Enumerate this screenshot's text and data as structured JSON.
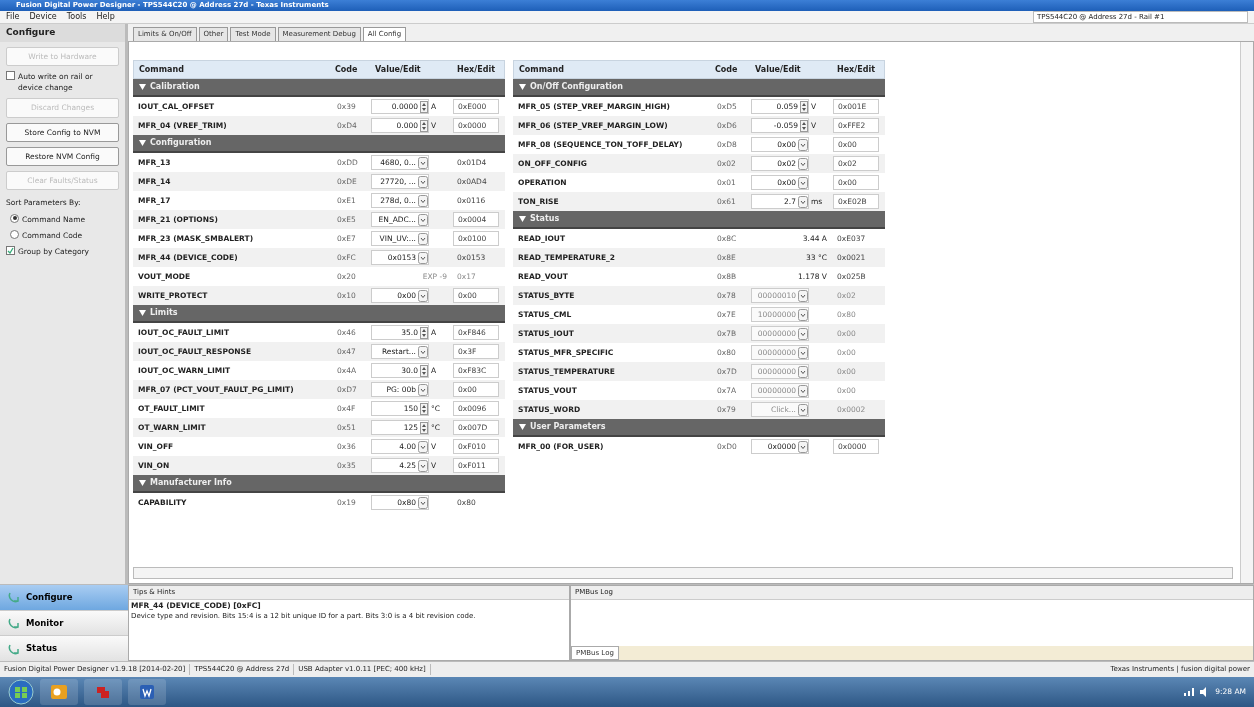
{
  "window": {
    "title": "Fusion Digital Power Designer - TPS544C20 @ Address 27d - Texas Instruments"
  },
  "menu": [
    "File",
    "Device",
    "Tools",
    "Help"
  ],
  "device_selector": {
    "value": "TPS544C20 @ Address 27d - Rail #1"
  },
  "sidebar": {
    "title": "Configure",
    "controls": [
      {
        "kind": "button",
        "label": "Write to Hardware",
        "disabled": true
      },
      {
        "kind": "checkbox",
        "label": "Auto write on rail or device change",
        "checked": false
      },
      {
        "kind": "button",
        "label": "Discard Changes",
        "disabled": true
      },
      {
        "kind": "button",
        "label": "Store Config to NVM",
        "disabled": false
      },
      {
        "kind": "button",
        "label": "Restore NVM Config",
        "disabled": false
      },
      {
        "kind": "button",
        "label": "Clear Faults/Status",
        "disabled": true
      },
      {
        "kind": "label",
        "label": "Sort Parameters By:"
      },
      {
        "kind": "radio",
        "label": "Command Name",
        "selected": true
      },
      {
        "kind": "radio",
        "label": "Command Code",
        "selected": false
      },
      {
        "kind": "checkbox",
        "label": "Group by Category",
        "checked": true
      }
    ]
  },
  "tabs": [
    {
      "label": "Limits & On/Off",
      "selected": false
    },
    {
      "label": "Other",
      "selected": false
    },
    {
      "label": "Test Mode",
      "selected": false
    },
    {
      "label": "Measurement Debug",
      "selected": false
    },
    {
      "label": "All Config",
      "selected": true
    }
  ],
  "tables": [
    {
      "columns": [
        "Command",
        "Code",
        "Value/Edit",
        "Hex/Edit"
      ],
      "groups": [
        {
          "title": "Calibration",
          "expanded": true,
          "rows": [
            {
              "command": "IOUT_CAL_OFFSET",
              "code": "0x39",
              "kind": "spin",
              "value": "0.0000",
              "unit": "A",
              "hex": "0xE000",
              "hex_editable": true,
              "disabled": false
            },
            {
              "command": "MFR_04 (VREF_TRIM)",
              "code": "0xD4",
              "kind": "spin",
              "value": "0.000",
              "unit": "V",
              "hex": "0x0000",
              "hex_editable": true,
              "disabled": false
            }
          ]
        },
        {
          "title": "Configuration",
          "expanded": true,
          "rows": [
            {
              "command": "MFR_13",
              "code": "0xDD",
              "kind": "combo",
              "value": "4680, 0...",
              "hex": "0x01D4",
              "hex_editable": false,
              "disabled": false
            },
            {
              "command": "MFR_14",
              "code": "0xDE",
              "kind": "combo",
              "value": "27720, ...",
              "hex": "0x0AD4",
              "hex_editable": false,
              "disabled": false
            },
            {
              "command": "MFR_17",
              "code": "0xE1",
              "kind": "combo",
              "value": "278d, 0...",
              "hex": "0x0116",
              "hex_editable": false,
              "disabled": false
            },
            {
              "command": "MFR_21 (OPTIONS)",
              "code": "0xE5",
              "kind": "combo",
              "value": "EN_ADC...",
              "hex": "0x0004",
              "hex_editable": true,
              "disabled": false
            },
            {
              "command": "MFR_23 (MASK_SMBALERT)",
              "code": "0xE7",
              "kind": "combo",
              "value": "VIN_UV:...",
              "hex": "0x0100",
              "hex_editable": true,
              "disabled": false
            },
            {
              "command": "MFR_44 (DEVICE_CODE)",
              "code": "0xFC",
              "kind": "combo",
              "value": "0x0153",
              "hex": "0x0153",
              "hex_editable": false,
              "disabled": false
            },
            {
              "command": "VOUT_MODE",
              "code": "0x20",
              "kind": "text",
              "value": "EXP -9",
              "hex": "0x17",
              "hex_editable": false,
              "disabled": true
            },
            {
              "command": "WRITE_PROTECT",
              "code": "0x10",
              "kind": "combo",
              "value": "0x00",
              "hex": "0x00",
              "hex_editable": true,
              "disabled": false
            }
          ]
        },
        {
          "title": "Limits",
          "expanded": true,
          "rows": [
            {
              "command": "IOUT_OC_FAULT_LIMIT",
              "code": "0x46",
              "kind": "spin",
              "value": "35.0",
              "unit": "A",
              "hex": "0xF846",
              "hex_editable": true,
              "disabled": false
            },
            {
              "command": "IOUT_OC_FAULT_RESPONSE",
              "code": "0x47",
              "kind": "combo",
              "value": "Restart...",
              "hex": "0x3F",
              "hex_editable": true,
              "disabled": false
            },
            {
              "command": "IOUT_OC_WARN_LIMIT",
              "code": "0x4A",
              "kind": "spin",
              "value": "30.0",
              "unit": "A",
              "hex": "0xF83C",
              "hex_editable": true,
              "disabled": false
            },
            {
              "command": "MFR_07 (PCT_VOUT_FAULT_PG_LIMIT)",
              "code": "0xD7",
              "kind": "combo",
              "value": "PG: 00b",
              "hex": "0x00",
              "hex_editable": true,
              "disabled": false
            },
            {
              "command": "OT_FAULT_LIMIT",
              "code": "0x4F",
              "kind": "spin",
              "value": "150",
              "unit": "°C",
              "hex": "0x0096",
              "hex_editable": true,
              "disabled": false
            },
            {
              "command": "OT_WARN_LIMIT",
              "code": "0x51",
              "kind": "spin",
              "value": "125",
              "unit": "°C",
              "hex": "0x007D",
              "hex_editable": true,
              "disabled": false
            },
            {
              "command": "VIN_OFF",
              "code": "0x36",
              "kind": "combo",
              "value": "4.00",
              "unit": "V",
              "hex": "0xF010",
              "hex_editable": true,
              "disabled": false
            },
            {
              "command": "VIN_ON",
              "code": "0x35",
              "kind": "combo",
              "value": "4.25",
              "unit": "V",
              "hex": "0xF011",
              "hex_editable": true,
              "disabled": false
            }
          ]
        },
        {
          "title": "Manufacturer Info",
          "expanded": true,
          "rows": [
            {
              "command": "CAPABILITY",
              "code": "0x19",
              "kind": "combo",
              "value": "0x80",
              "hex": "0x80",
              "hex_editable": false,
              "disabled": false
            }
          ]
        }
      ]
    },
    {
      "columns": [
        "Command",
        "Code",
        "Value/Edit",
        "Hex/Edit"
      ],
      "groups": [
        {
          "title": "On/Off Configuration",
          "expanded": true,
          "rows": [
            {
              "command": "MFR_05 (STEP_VREF_MARGIN_HIGH)",
              "code": "0xD5",
              "kind": "spin",
              "value": "0.059",
              "unit": "V",
              "hex": "0x001E",
              "hex_editable": true,
              "disabled": false
            },
            {
              "command": "MFR_06 (STEP_VREF_MARGIN_LOW)",
              "code": "0xD6",
              "kind": "spin",
              "value": "-0.059",
              "unit": "V",
              "hex": "0xFFE2",
              "hex_editable": true,
              "disabled": false
            },
            {
              "command": "MFR_08 (SEQUENCE_TON_TOFF_DELAY)",
              "code": "0xD8",
              "kind": "combo",
              "value": "0x00",
              "hex": "0x00",
              "hex_editable": true,
              "disabled": false
            },
            {
              "command": "ON_OFF_CONFIG",
              "code": "0x02",
              "kind": "combo",
              "value": "0x02",
              "hex": "0x02",
              "hex_editable": true,
              "disabled": false
            },
            {
              "command": "OPERATION",
              "code": "0x01",
              "kind": "combo",
              "value": "0x00",
              "hex": "0x00",
              "hex_editable": true,
              "disabled": false
            },
            {
              "command": "TON_RISE",
              "code": "0x61",
              "kind": "combo",
              "value": "2.7",
              "unit": "ms",
              "hex": "0xE02B",
              "hex_editable": true,
              "disabled": false
            }
          ]
        },
        {
          "title": "Status",
          "expanded": true,
          "rows": [
            {
              "command": "READ_IOUT",
              "code": "0x8C",
              "kind": "text",
              "value": "3.44 A",
              "hex": "0xE037",
              "hex_editable": false,
              "disabled": false
            },
            {
              "command": "READ_TEMPERATURE_2",
              "code": "0x8E",
              "kind": "text",
              "value": "33 °C",
              "hex": "0x0021",
              "hex_editable": false,
              "disabled": false
            },
            {
              "command": "READ_VOUT",
              "code": "0x8B",
              "kind": "text",
              "value": "1.178 V",
              "hex": "0x025B",
              "hex_editable": false,
              "disabled": false
            },
            {
              "command": "STATUS_BYTE",
              "code": "0x78",
              "kind": "combo",
              "value": "00000010",
              "hex": "0x02",
              "hex_editable": false,
              "disabled": true
            },
            {
              "command": "STATUS_CML",
              "code": "0x7E",
              "kind": "combo",
              "value": "10000000",
              "hex": "0x80",
              "hex_editable": false,
              "disabled": true
            },
            {
              "command": "STATUS_IOUT",
              "code": "0x7B",
              "kind": "combo",
              "value": "00000000",
              "hex": "0x00",
              "hex_editable": false,
              "disabled": true
            },
            {
              "command": "STATUS_MFR_SPECIFIC",
              "code": "0x80",
              "kind": "combo",
              "value": "00000000",
              "hex": "0x00",
              "hex_editable": false,
              "disabled": true
            },
            {
              "command": "STATUS_TEMPERATURE",
              "code": "0x7D",
              "kind": "combo",
              "value": "00000000",
              "hex": "0x00",
              "hex_editable": false,
              "disabled": true
            },
            {
              "command": "STATUS_VOUT",
              "code": "0x7A",
              "kind": "combo",
              "value": "00000000",
              "hex": "0x00",
              "hex_editable": false,
              "disabled": true
            },
            {
              "command": "STATUS_WORD",
              "code": "0x79",
              "kind": "combo",
              "value": "Click...",
              "hex": "0x0002",
              "hex_editable": false,
              "disabled": true
            }
          ]
        },
        {
          "title": "User Parameters",
          "expanded": true,
          "rows": [
            {
              "command": "MFR_00 (FOR_USER)",
              "code": "0xD0",
              "kind": "combo",
              "value": "0x0000",
              "hex": "0x0000",
              "hex_editable": true,
              "disabled": false
            }
          ]
        }
      ]
    }
  ],
  "nav": [
    {
      "label": "Configure",
      "selected": true
    },
    {
      "label": "Monitor",
      "selected": false
    },
    {
      "label": "Status",
      "selected": false
    }
  ],
  "tips": {
    "title": "Tips & Hints",
    "heading": "MFR_44 (DEVICE_CODE) [0xFC]",
    "text": "Device type and revision. Bits 15:4 is a 12 bit unique ID for a part. Bits 3:0 is a 4 bit revision code."
  },
  "log": {
    "title": "PMBus Log",
    "tab": "PMBus Log"
  },
  "status_bar": [
    "Fusion Digital Power Designer v1.9.18 [2014-02-20]",
    "TPS544C20 @ Address 27d",
    "USB Adapter v1.0.11 [PEC; 400 kHz]"
  ],
  "status_brand": "Texas Instruments | fusion digital power",
  "taskbar": {
    "time": "9:28 AM"
  }
}
